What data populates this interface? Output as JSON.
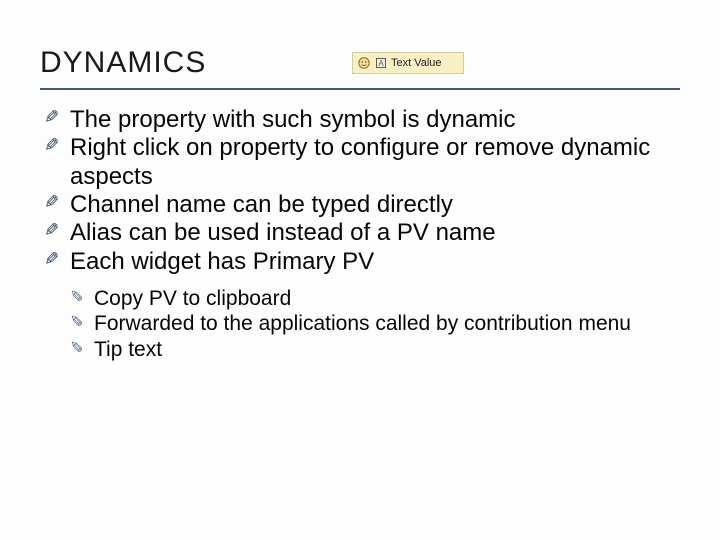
{
  "title": "DYNAMICS",
  "figure": {
    "label": "Text Value"
  },
  "bullets": [
    "The property with such symbol is dynamic",
    "Right click on property to configure or remove dynamic aspects",
    "Channel name can be typed directly",
    "Alias can be used instead of a PV name",
    "Each widget has Primary PV"
  ],
  "sub_bullets": [
    "Copy PV to clipboard",
    "Forwarded to the applications called by contribution menu",
    "Tip text"
  ]
}
